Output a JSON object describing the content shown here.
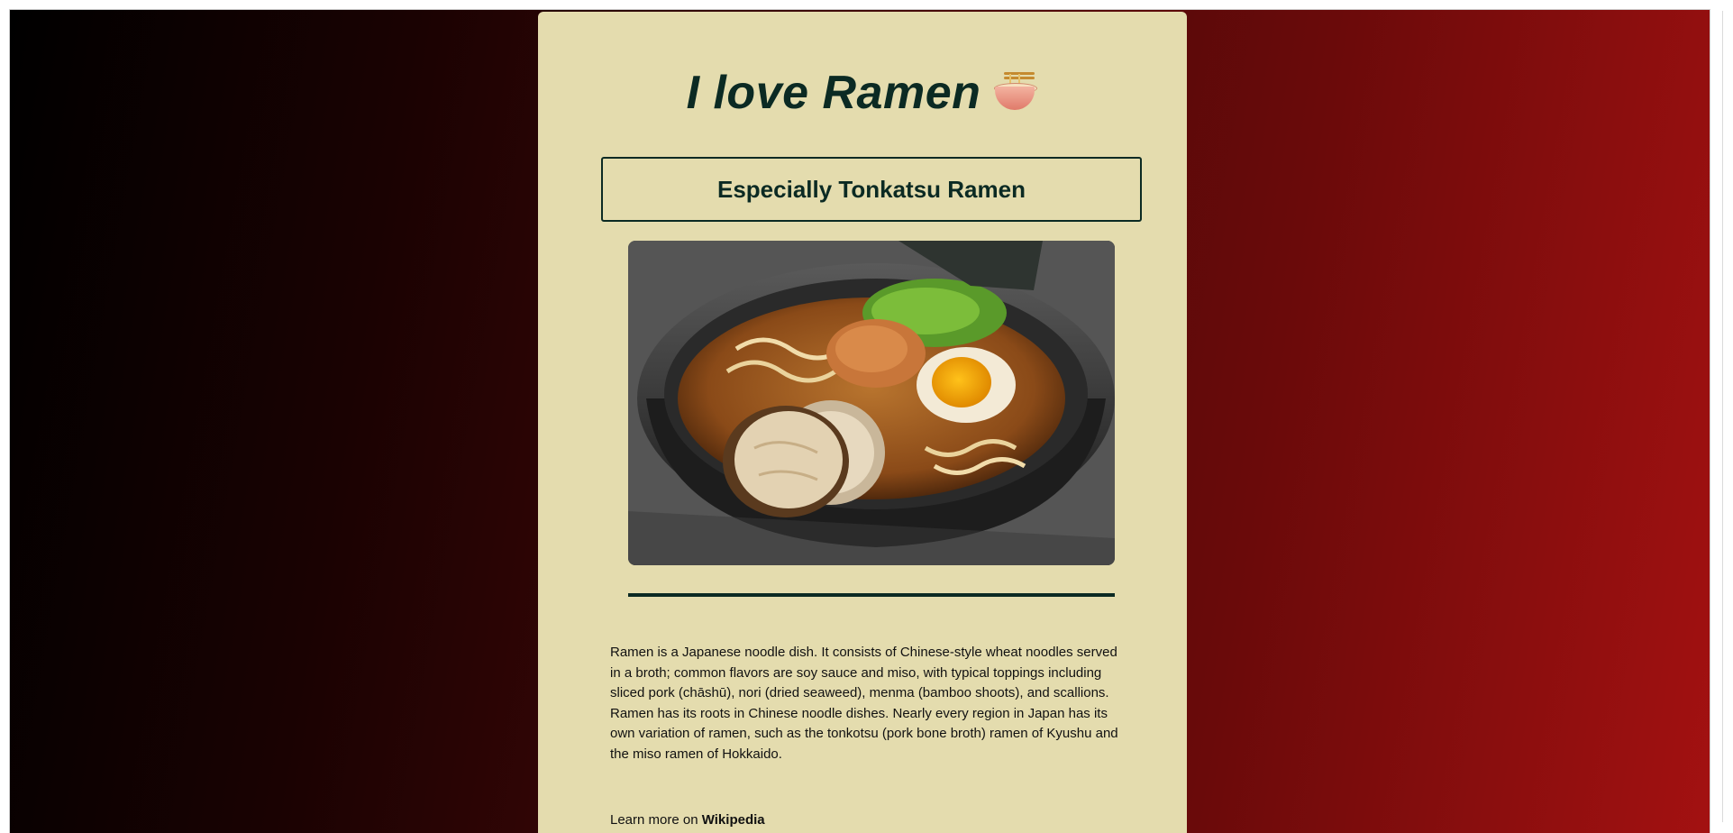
{
  "page": {
    "title": "I love Ramen",
    "title_emoji_icon": "ramen-bowl-icon",
    "subtitle": "Especially Tonkatsu Ramen",
    "image_alt": "Bowl of tonkatsu ramen",
    "description": "Ramen is a Japanese noodle dish. It consists of Chinese-style wheat noodles served in a broth; common flavors are soy sauce and miso, with typical toppings including sliced pork (chāshū), nori (dried seaweed), menma (bamboo shoots), and scallions. Ramen has its roots in Chinese noodle dishes. Nearly every region in Japan has its own variation of ramen, such as the tonkotsu (pork bone broth) ramen of Kyushu and the miso ramen of Hokkaido.",
    "learn_more_prefix": "Learn more on",
    "learn_more_link": "Wikipedia"
  },
  "colors": {
    "card_background": "#e4dcae",
    "text_dark": "#0b2a23",
    "gradient_start": "#000000",
    "gradient_end": "#a31111"
  }
}
